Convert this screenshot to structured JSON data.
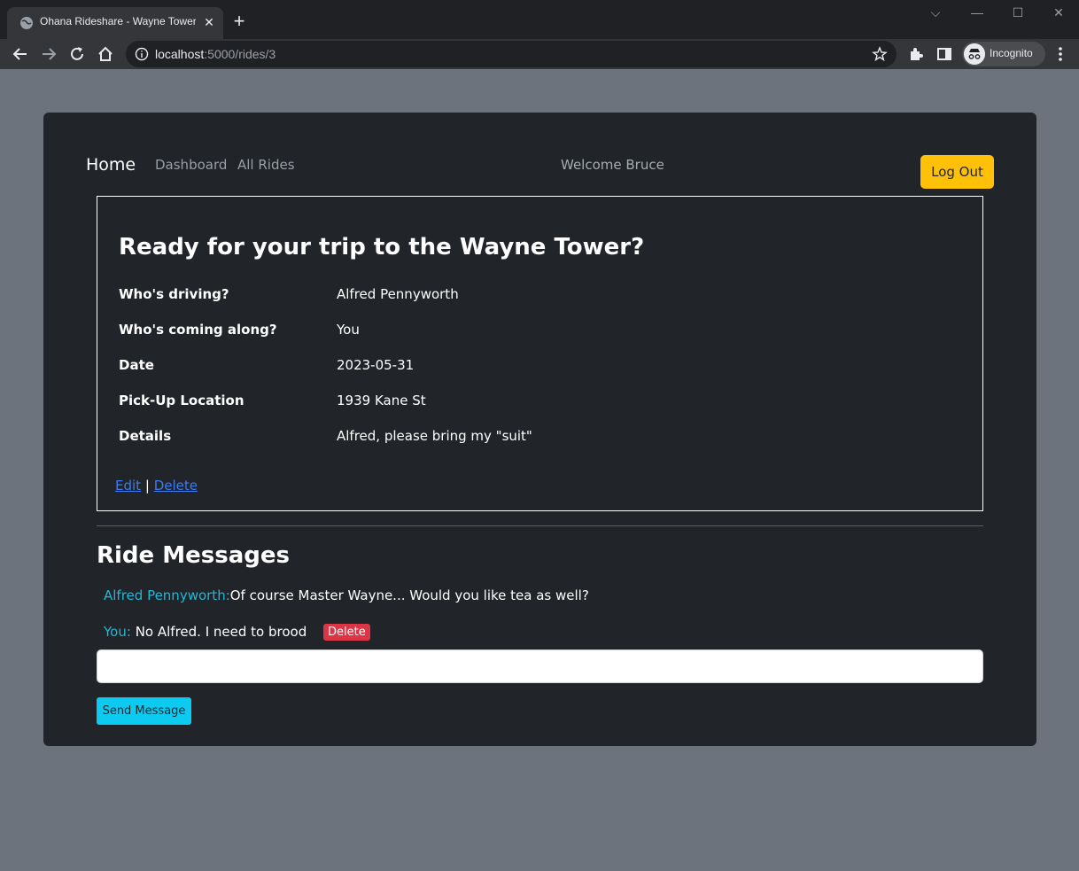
{
  "browser": {
    "tab_title": "Ohana Rideshare - Wayne Tower",
    "tab_close": "✕",
    "new_tab": "+",
    "url_host": "localhost",
    "url_path": ":5000/rides/3",
    "profile_label": "Incognito",
    "window_controls": {
      "dropdown": "⌵",
      "minimize": "—",
      "maximize": "☐",
      "close": "✕"
    }
  },
  "nav": {
    "home": "Home",
    "dashboard": "Dashboard",
    "all_rides": "All Rides",
    "welcome": "Welcome Bruce",
    "logout": "Log Out"
  },
  "ride": {
    "heading": "Ready for your trip to the Wayne Tower?",
    "rows": [
      {
        "label": "Who's driving?",
        "value": "Alfred Pennyworth"
      },
      {
        "label": "Who's coming along?",
        "value": "You"
      },
      {
        "label": "Date",
        "value": "2023-05-31"
      },
      {
        "label": "Pick-Up Location",
        "value": "1939 Kane St"
      },
      {
        "label": "Details",
        "value": "Alfred, please bring my \"suit\""
      }
    ],
    "edit_link": "Edit",
    "separator": "|",
    "delete_link": "Delete"
  },
  "messages": {
    "heading": "Ride Messages",
    "items": [
      {
        "author": "Alfred Pennyworth:",
        "text": "Of course Master Wayne... Would you like tea as well?"
      },
      {
        "author": "You:",
        "text": "No Alfred. I need to brood",
        "delete_label": "Delete"
      }
    ],
    "input_value": "",
    "send_label": "Send Message"
  },
  "colors": {
    "page_bg": "#6c737d",
    "card_bg": "#212529",
    "accent_yellow": "#ffc107",
    "accent_cyan": "#0dcaf0",
    "danger": "#dc3545",
    "link": "#3d7bf0"
  },
  "icons": {
    "favicon": "globe-icon",
    "back": "arrow-left-icon",
    "forward": "arrow-right-icon",
    "reload": "reload-icon",
    "home": "home-icon",
    "info": "info-icon",
    "bookmark": "star-icon",
    "extensions": "puzzle-icon",
    "side_panel": "side-panel-icon",
    "incognito": "incognito-icon",
    "menu": "kebab-menu-icon"
  }
}
